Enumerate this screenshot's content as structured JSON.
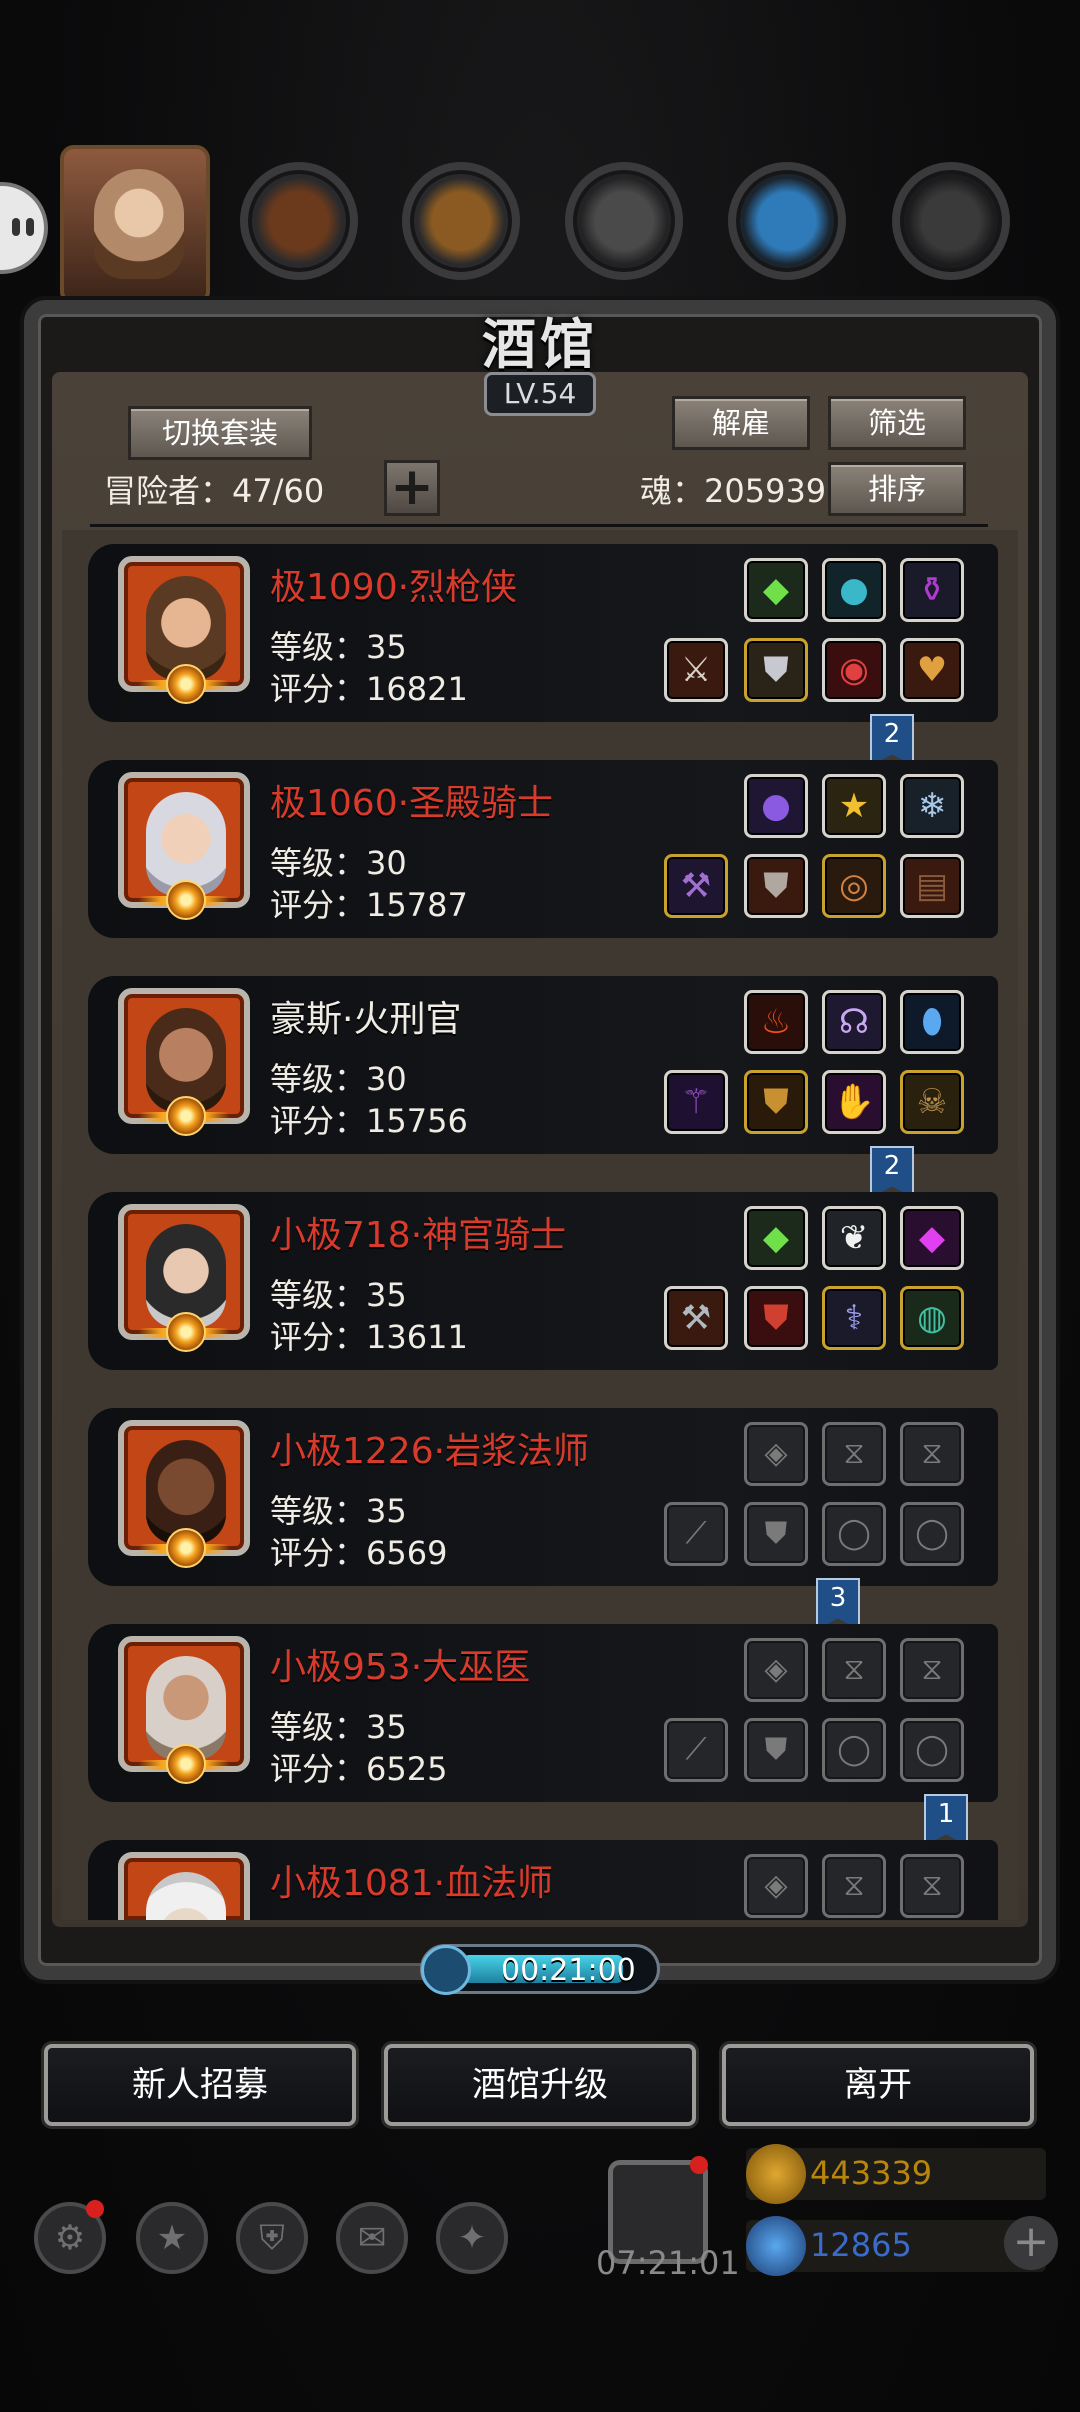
{
  "window": {
    "title": "酒馆",
    "level": "LV.54"
  },
  "toolbar": {
    "switch_outfit": "切换套装",
    "dismiss": "解雇",
    "filter": "筛选",
    "sort": "排序",
    "adventurer_count": "冒险者：47/60",
    "add": "+",
    "soul": "魂：205939"
  },
  "heroes": [
    {
      "name": "极1090·烈枪侠",
      "level": "等级：35",
      "score": "评分：16821",
      "name_color": "red"
    },
    {
      "name": "极1060·圣殿骑士",
      "level": "等级：30",
      "score": "评分：15787",
      "name_color": "red"
    },
    {
      "name": "豪斯·火刑官",
      "level": "等级：30",
      "score": "评分：15756",
      "name_color": "white"
    },
    {
      "name": "小极718·神官骑士",
      "level": "等级：35",
      "score": "评分：13611",
      "name_color": "red"
    },
    {
      "name": "小极1226·岩浆法师",
      "level": "等级：35",
      "score": "评分：6569",
      "name_color": "red"
    },
    {
      "name": "小极953·大巫医",
      "level": "等级：35",
      "score": "评分：6525",
      "name_color": "red"
    },
    {
      "name": "小极1081·血法师",
      "level": "",
      "score": "",
      "name_color": "red"
    }
  ],
  "ribbons": [
    "2",
    "2",
    "3",
    "1"
  ],
  "timer": "00:21:00",
  "bottom_buttons": {
    "recruit": "新人招募",
    "upgrade": "酒馆升级",
    "leave": "离开"
  },
  "footer": {
    "gift_timer": "07:21:01",
    "gold": "443339",
    "gems": "12865"
  },
  "colors": {
    "name_red": "#d83b2b",
    "accent_blue": "#1f4f86",
    "timer_cyan": "#47d3e8",
    "gold_text": "#b8860b",
    "gem_text": "#3a6bc8"
  }
}
